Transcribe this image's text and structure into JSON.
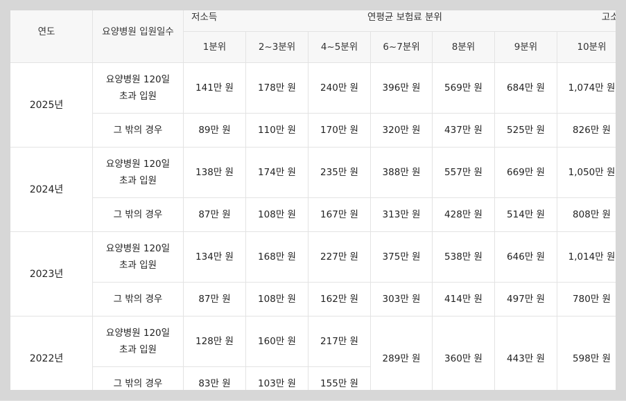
{
  "headers": {
    "year": "연도",
    "days": "요양병원 입원일수",
    "band_title": "연평균 보험료 분위",
    "band_low": "저소득",
    "band_high": "고소득",
    "deciles": [
      "1분위",
      "2~3분위",
      "4~5분위",
      "6~7분위",
      "8분위",
      "9분위",
      "10분위"
    ]
  },
  "row_labels": {
    "over120_line1": "요양병원 120일",
    "over120_line2": "초과 입원",
    "other": "그 밖의 경우"
  },
  "years": [
    {
      "year": "2025년",
      "over120": [
        "141만 원",
        "178만 원",
        "240만 원",
        "396만 원",
        "569만 원",
        "684만 원",
        "1,074만 원"
      ],
      "other": [
        "89만 원",
        "110만 원",
        "170만 원",
        "320만 원",
        "437만 원",
        "525만 원",
        "826만 원"
      ]
    },
    {
      "year": "2024년",
      "over120": [
        "138만 원",
        "174만 원",
        "235만 원",
        "388만 원",
        "557만 원",
        "669만 원",
        "1,050만 원"
      ],
      "other": [
        "87만 원",
        "108만 원",
        "167만 원",
        "313만 원",
        "428만 원",
        "514만 원",
        "808만 원"
      ]
    },
    {
      "year": "2023년",
      "over120": [
        "134만 원",
        "168만 원",
        "227만 원",
        "375만 원",
        "538만 원",
        "646만 원",
        "1,014만 원"
      ],
      "other": [
        "87만 원",
        "108만 원",
        "162만 원",
        "303만 원",
        "414만 원",
        "497만 원",
        "780만 원"
      ]
    },
    {
      "year": "2022년",
      "over120": [
        "128만 원",
        "160만 원",
        "217만 원"
      ],
      "other": [
        "83만 원",
        "103만 원",
        "155만 원"
      ],
      "merged": [
        "289만 원",
        "360만 원",
        "443만 원",
        "598만 원"
      ]
    }
  ]
}
